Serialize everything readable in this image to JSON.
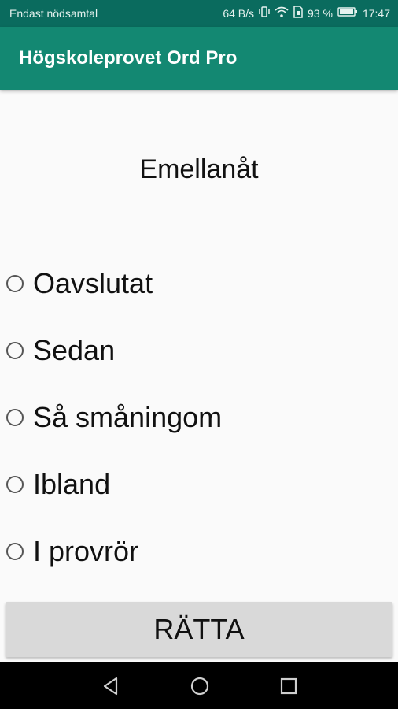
{
  "status_bar": {
    "carrier": "Endast nödsamtal",
    "speed": "64 B/s",
    "battery": "93 %",
    "time": "17:47"
  },
  "app_bar": {
    "title": "Högskoleprovet Ord Pro"
  },
  "question": {
    "word": "Emellanåt"
  },
  "options": [
    {
      "label": "Oavslutat"
    },
    {
      "label": "Sedan"
    },
    {
      "label": "Så småningom"
    },
    {
      "label": "Ibland"
    },
    {
      "label": "I provrör"
    }
  ],
  "check_button": {
    "label": "RÄTTA"
  },
  "nav": {
    "back": "back-icon",
    "home": "home-icon",
    "recents": "recents-icon"
  },
  "colors": {
    "status_bar": "#0a6b5e",
    "app_bar": "#138872",
    "button": "#d9d9d9"
  }
}
